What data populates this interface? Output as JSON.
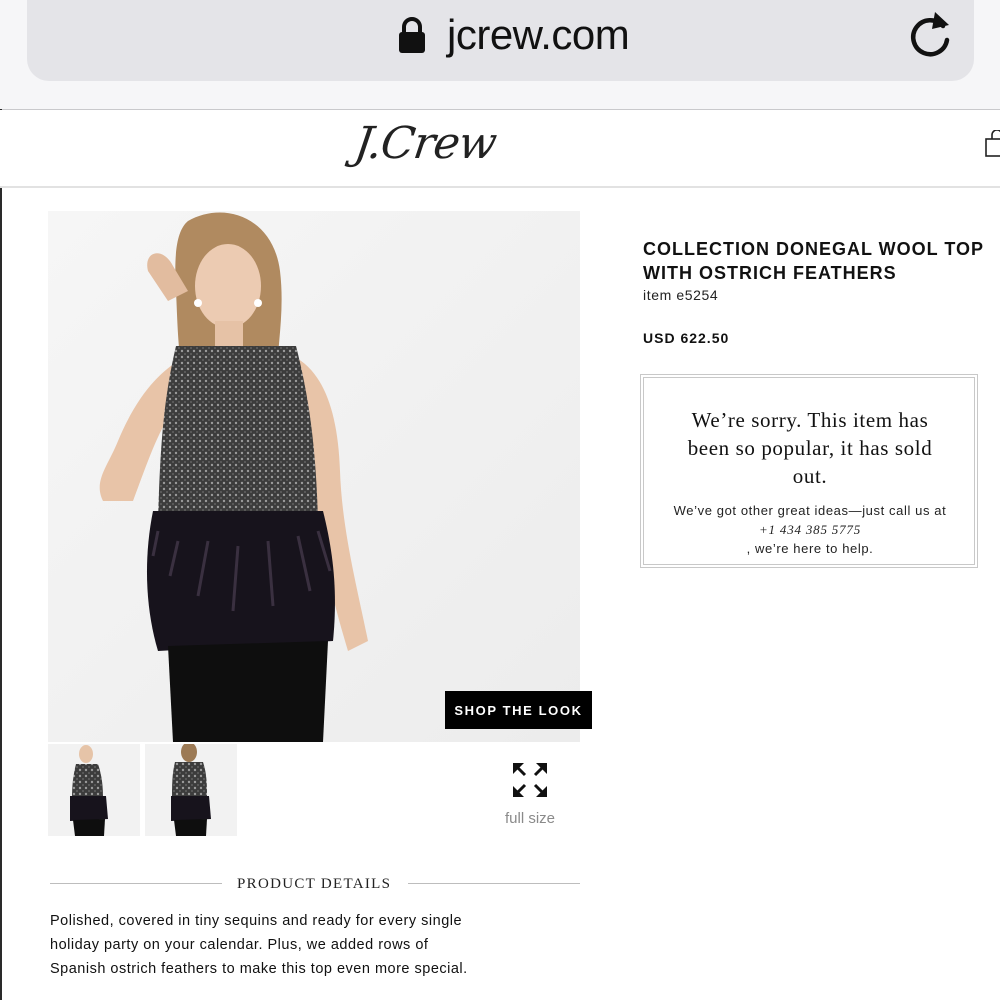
{
  "browser": {
    "url": "jcrew.com"
  },
  "site": {
    "logo_text": "J.Crew"
  },
  "product": {
    "name_lines": [
      "COLLECTION DONEGAL WOOL TOP",
      "WITH OSTRICH FEATHERS"
    ],
    "item_number": "item e5254",
    "price": "USD 622.50"
  },
  "sold_out": {
    "message_lines": [
      "We’re sorry. This item has",
      "been so popular, it has sold",
      "out."
    ],
    "help_before": "We’ve got other great ideas—just call us at",
    "phone": "+1 434 385 5775",
    "help_after": ", we’re here to help."
  },
  "gallery": {
    "shop_the_look_label": "SHOP THE LOOK",
    "full_size_label": "full size",
    "thumbnail_count": 2
  },
  "details": {
    "heading": "PRODUCT DETAILS",
    "description_lines": [
      "Polished, covered in tiny sequins and ready for every single",
      "holiday party on your calendar. Plus, we added rows of",
      "Spanish ostrich feathers to make this top even more special."
    ]
  },
  "colors": {
    "button_bg": "#000000",
    "url_bar_bg": "#e4e4e8",
    "muted_text": "#8a8a8a"
  },
  "icons": [
    "lock-icon",
    "reload-icon",
    "shopping-bag-icon",
    "expand-icon"
  ]
}
